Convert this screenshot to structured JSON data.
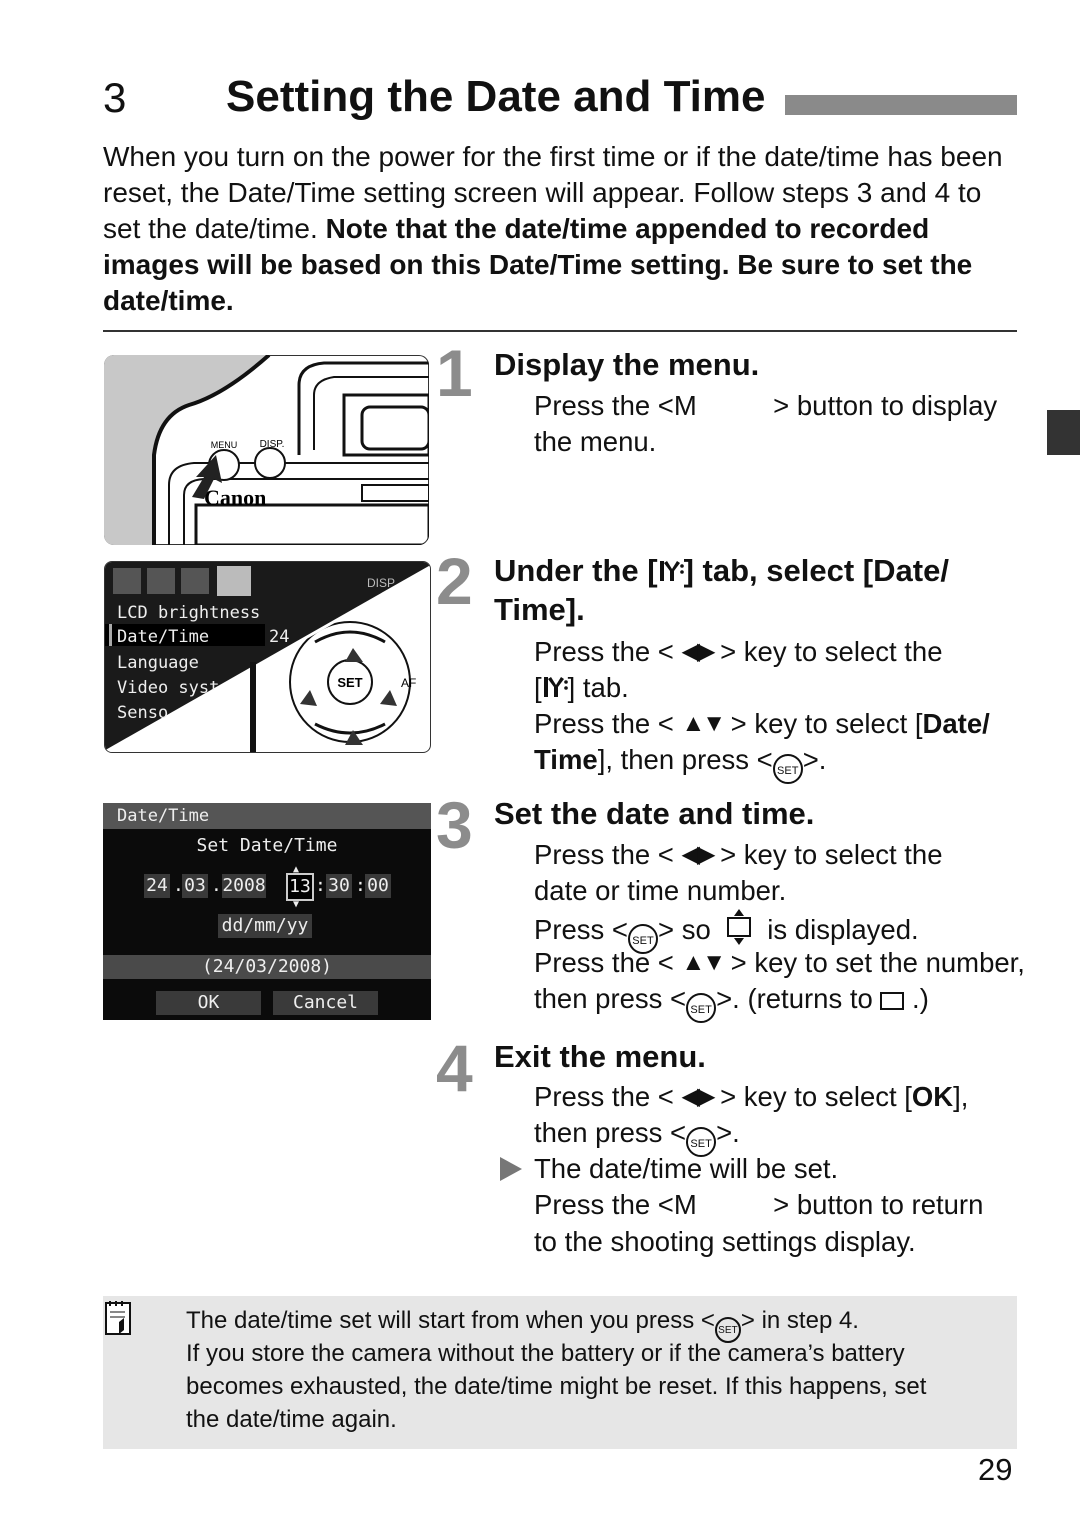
{
  "header": {
    "chapter_number": "3",
    "title": "Setting the Date and Time"
  },
  "intro": {
    "plain": "When you turn on the power for the first time or if the date/time has been reset, the Date/Time setting screen will appear. Follow steps 3 and 4 to set the date/time. ",
    "bold": "Note that the date/time appended to recorded images will be based on this Date/Time setting. Be sure to set the date/time."
  },
  "steps": [
    {
      "number": "1",
      "heading": [
        "Display the menu."
      ],
      "lines": [
        [
          {
            "t": "Press the <M          > button to display"
          }
        ],
        [
          {
            "t": "the menu."
          }
        ]
      ]
    },
    {
      "number": "2",
      "heading": [
        "Under the [",
        {
          "icon": "setup-tab"
        },
        "] tab, select [Date/",
        "Time]."
      ],
      "lines": [
        [
          {
            "t": "Press the < "
          },
          {
            "icon": "left-right-key"
          },
          {
            "t": " > key to select the"
          }
        ],
        [
          {
            "t": "["
          },
          {
            "icon": "setup-tab"
          },
          {
            "t": "] tab."
          }
        ],
        [
          {
            "t": "Press the < "
          },
          {
            "icon": "up-down-key"
          },
          {
            "t": " > key to select ["
          },
          {
            "b": "Date/"
          }
        ],
        [
          {
            "b": "Time"
          },
          {
            "t": "], then press <"
          },
          {
            "icon": "set-button"
          },
          {
            "t": ">."
          }
        ]
      ]
    },
    {
      "number": "3",
      "heading": [
        "Set the date and time."
      ],
      "lines": [
        [
          {
            "t": "Press the < "
          },
          {
            "icon": "left-right-key"
          },
          {
            "t": " > key to select the"
          }
        ],
        [
          {
            "t": "date or time number."
          }
        ],
        [
          {
            "t": "Press <"
          },
          {
            "icon": "set-button"
          },
          {
            "t": "> so  "
          },
          {
            "icon": "adjust-box"
          },
          {
            "t": "  is displayed."
          }
        ],
        [
          {
            "t": "Press the < "
          },
          {
            "icon": "up-down-key"
          },
          {
            "t": " > key to set the number,"
          }
        ],
        [
          {
            "t": "then press <"
          },
          {
            "icon": "set-button"
          },
          {
            "t": ">. (returns to "
          },
          {
            "icon": "select-box"
          },
          {
            "t": " .)"
          }
        ]
      ]
    },
    {
      "number": "4",
      "heading": [
        "Exit the menu."
      ],
      "lines": [
        [
          {
            "t": "Press the < "
          },
          {
            "icon": "left-right-key"
          },
          {
            "t": " > key to select ["
          },
          {
            "b": "OK"
          },
          {
            "t": "],"
          }
        ],
        [
          {
            "t": "then press <"
          },
          {
            "icon": "set-button"
          },
          {
            "t": ">."
          }
        ],
        [
          {
            "t": "The date/time will be set."
          }
        ],
        [
          {
            "t": "Press the <M          > button to return"
          }
        ],
        [
          {
            "t": "to the shooting settings display."
          }
        ]
      ]
    }
  ],
  "illustrations": {
    "camera_labels": {
      "menu": "MENU",
      "disp": "DISP.",
      "brand": "Canon"
    },
    "menu_screen": {
      "items": [
        "LCD brightness",
        "Date/Time",
        "Language",
        "Video syst",
        "Senso"
      ],
      "date_partial": "24",
      "disp": "DISP",
      "set": "SET",
      "af": "AF"
    },
    "datetime_screen": {
      "header": "Date/Time",
      "subtitle": "Set Date/Time",
      "day": "24",
      "month": "03",
      "year": "2008",
      "hour": "13",
      "minute": "30",
      "second": "00",
      "format": "dd/mm/yy",
      "preview": "(24/03/2008)",
      "ok": "OK",
      "cancel": "Cancel"
    }
  },
  "note": {
    "lines": [
      [
        {
          "t": "The date/time set will start from when you press <"
        },
        {
          "icon": "set-button"
        },
        {
          "t": "> in step 4."
        }
      ],
      [
        {
          "t": "If you store the camera without the battery or if the camera’s battery"
        }
      ],
      [
        {
          "t": "becomes exhausted, the date/time might be reset. If this happens, set"
        }
      ],
      [
        {
          "t": "the date/time again."
        }
      ]
    ]
  },
  "footer": {
    "page_number": "29"
  },
  "icons": {
    "set-button": "circled SET",
    "left-right-key": "◀▶",
    "up-down-key": "▲▼",
    "setup-tab": "wrench tab",
    "adjust-box": "box with up/down arrows",
    "select-box": "empty box",
    "note-icon": "memo pad"
  },
  "colors": {
    "step_number": "#8c8c8c",
    "title_bar": "#8a8a8a",
    "note_bg": "#e6e6e6"
  }
}
